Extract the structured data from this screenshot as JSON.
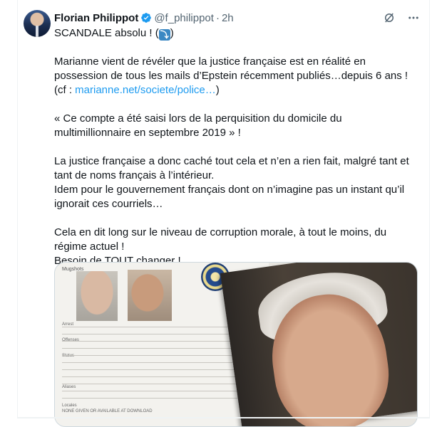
{
  "tweet": {
    "display_name": "Florian Philippot",
    "handle": "@f_philippot",
    "separator": "·",
    "time": "2h",
    "icons": [
      "verified-badge-icon",
      "grok-icon",
      "more-icon"
    ],
    "lines": [
      "SCANDALE absolu ! (",
      "Marianne vient de révéler que la justice française est en réalité en",
      "possession de tous les mails d’Epstein récemment publiés…depuis 6 ans !",
      "(cf : ",
      "marianne.net/societe/police…",
      ")",
      " « Ce compte a été saisi lors de la perquisition du domicile du",
      "multimillionnaire en septembre 2019 » !",
      "La justice française a donc caché tout cela et n’en a rien fait, malgré tant et",
      "tant de noms français à l’intérieur.",
      "Idem pour le gouvernement français dont on n’imagine pas un instant qu’il",
      "ignorait ces courriels…",
      "Cela en dit long sur le niveau de corruption morale, à tout le moins, du",
      "régime actuel !",
      "Besoin de TOUT changer !"
    ],
    "emoji_glyph": "⤵",
    "emoji_close": ")",
    "media": {
      "doc_header": "Mugshots",
      "form_labels": [
        "Arrest",
        "Offenses",
        "Status",
        "Aliases",
        "Locales"
      ],
      "locales_text": "NONE GIVEN OR AVAILABLE AT DOWNLOAD"
    }
  },
  "colors": {
    "accent": "#1d9bf0",
    "text": "#0f1419",
    "muted": "#536471",
    "border": "#cfd9de"
  }
}
